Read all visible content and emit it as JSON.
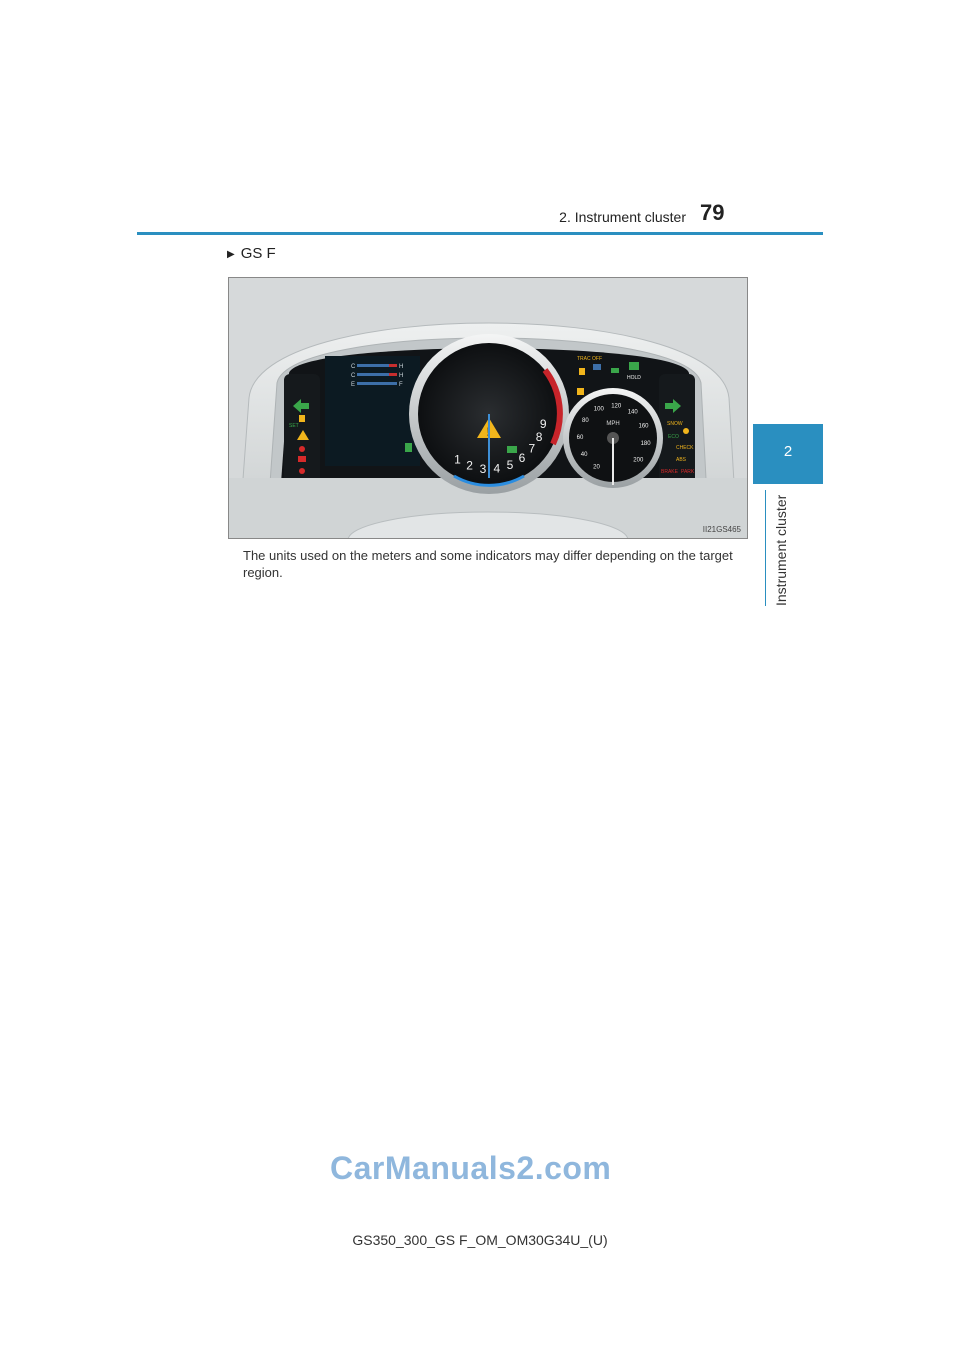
{
  "header": {
    "section_title": "2. Instrument cluster",
    "page_number": "79"
  },
  "side_tab": {
    "chapter_number": "2",
    "chapter_label": "Instrument cluster"
  },
  "section": {
    "marker": "▶",
    "heading": "GS F"
  },
  "figure": {
    "image_id_label": "II21GS465",
    "tachometer": {
      "ticks": [
        "1",
        "2",
        "3",
        "4",
        "5",
        "6",
        "7",
        "8",
        "9"
      ]
    },
    "speedometer": {
      "unit": "MPH",
      "ticks": [
        "20",
        "40",
        "60",
        "80",
        "100",
        "120",
        "140",
        "160",
        "180",
        "200"
      ]
    },
    "gauges": [
      {
        "left": "C",
        "right": "H"
      },
      {
        "left": "C",
        "right": "H"
      },
      {
        "left": "E",
        "right": "F"
      }
    ],
    "indicator_texts": [
      "TRAC OFF",
      "HOLD",
      "SET",
      "SNOW",
      "ECO",
      "CHECK",
      "ABS",
      "BRAKE",
      "PARK"
    ]
  },
  "caption": "The units used on the meters and some indicators may differ depending on the target region.",
  "watermark": "CarManuals2.com",
  "footer": "GS350_300_GS F_OM_OM30G34U_(U)"
}
